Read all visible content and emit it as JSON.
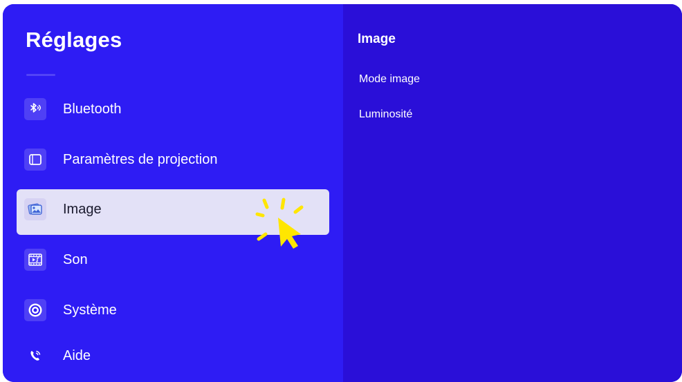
{
  "app": {
    "title": "Réglages"
  },
  "sidebar": {
    "items": [
      {
        "label": "Bluetooth",
        "icon": "bluetooth-icon"
      },
      {
        "label": "Paramètres de projection",
        "icon": "window-icon"
      },
      {
        "label": "Image",
        "icon": "image-icon",
        "selected": true
      },
      {
        "label": "Son",
        "icon": "sound-icon"
      },
      {
        "label": "Système",
        "icon": "gear-icon"
      },
      {
        "label": "Aide",
        "icon": "phone-icon"
      }
    ]
  },
  "detail": {
    "title": "Image",
    "items": [
      {
        "label": "Mode image"
      },
      {
        "label": "Luminosité"
      }
    ]
  },
  "colors": {
    "left_panel": "#2e1cf4",
    "right_panel": "#2a0fd8",
    "selected_row": "#e3e1f7",
    "pointer": "#ffe600"
  }
}
